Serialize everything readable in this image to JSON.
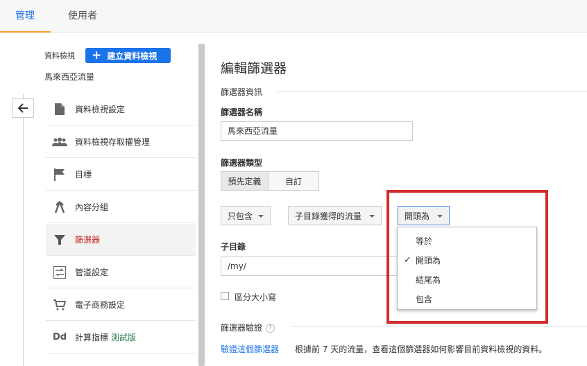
{
  "tabs": [
    {
      "label": "管理",
      "active": true
    },
    {
      "label": "使用者",
      "active": false
    }
  ],
  "sidebar": {
    "view_label": "資料檢視",
    "create_view_label": "建立資料檢視",
    "view_name": "馬來西亞流量",
    "items": [
      {
        "label": "資料檢視設定",
        "icon": "document-icon"
      },
      {
        "label": "資料檢視存取權管理",
        "icon": "people-icon"
      },
      {
        "label": "目標",
        "icon": "flag-icon"
      },
      {
        "label": "內容分組",
        "icon": "content-grouping-icon"
      },
      {
        "label": "篩選器",
        "icon": "filter-icon",
        "active": true
      },
      {
        "label": "管道設定",
        "icon": "channel-settings-icon"
      },
      {
        "label": "電子商務設定",
        "icon": "cart-icon"
      },
      {
        "label": "計算指標",
        "beta": "測試版",
        "icon": "dd-icon"
      }
    ]
  },
  "main": {
    "title": "編輯篩選器",
    "filter_info_label": "篩選器資訊",
    "filter_name_label": "篩選器名稱",
    "filter_name_value": "馬來西亞流量",
    "filter_type_label": "篩選器類型",
    "filter_type_options": [
      "預先定義",
      "自訂"
    ],
    "filter_type_selected": "預先定義",
    "include_dropdown": "只包含",
    "source_dropdown": "子目錄獲得的流量",
    "match_dropdown": "開頭為",
    "match_options": [
      "等於",
      "開頭為",
      "結尾為",
      "包含"
    ],
    "match_selected_index": 1,
    "subdirectory_label": "子目錄",
    "subdirectory_value": "/my/",
    "case_sensitive_label": "區分大小寫",
    "case_sensitive_checked": false,
    "verify_section_label": "篩選器驗證",
    "help_glyph": "?",
    "verify_link": "驗證這個篩選器",
    "verify_desc": "根據前 7 天的流量，查看這個篩選器如何影響目前資料檢視的資料。"
  },
  "colors": {
    "accent": "#1a73e8",
    "active_nav_text": "#c5221f",
    "tab_underline": "#f39c2b",
    "highlight_box": "#d12c2c"
  }
}
